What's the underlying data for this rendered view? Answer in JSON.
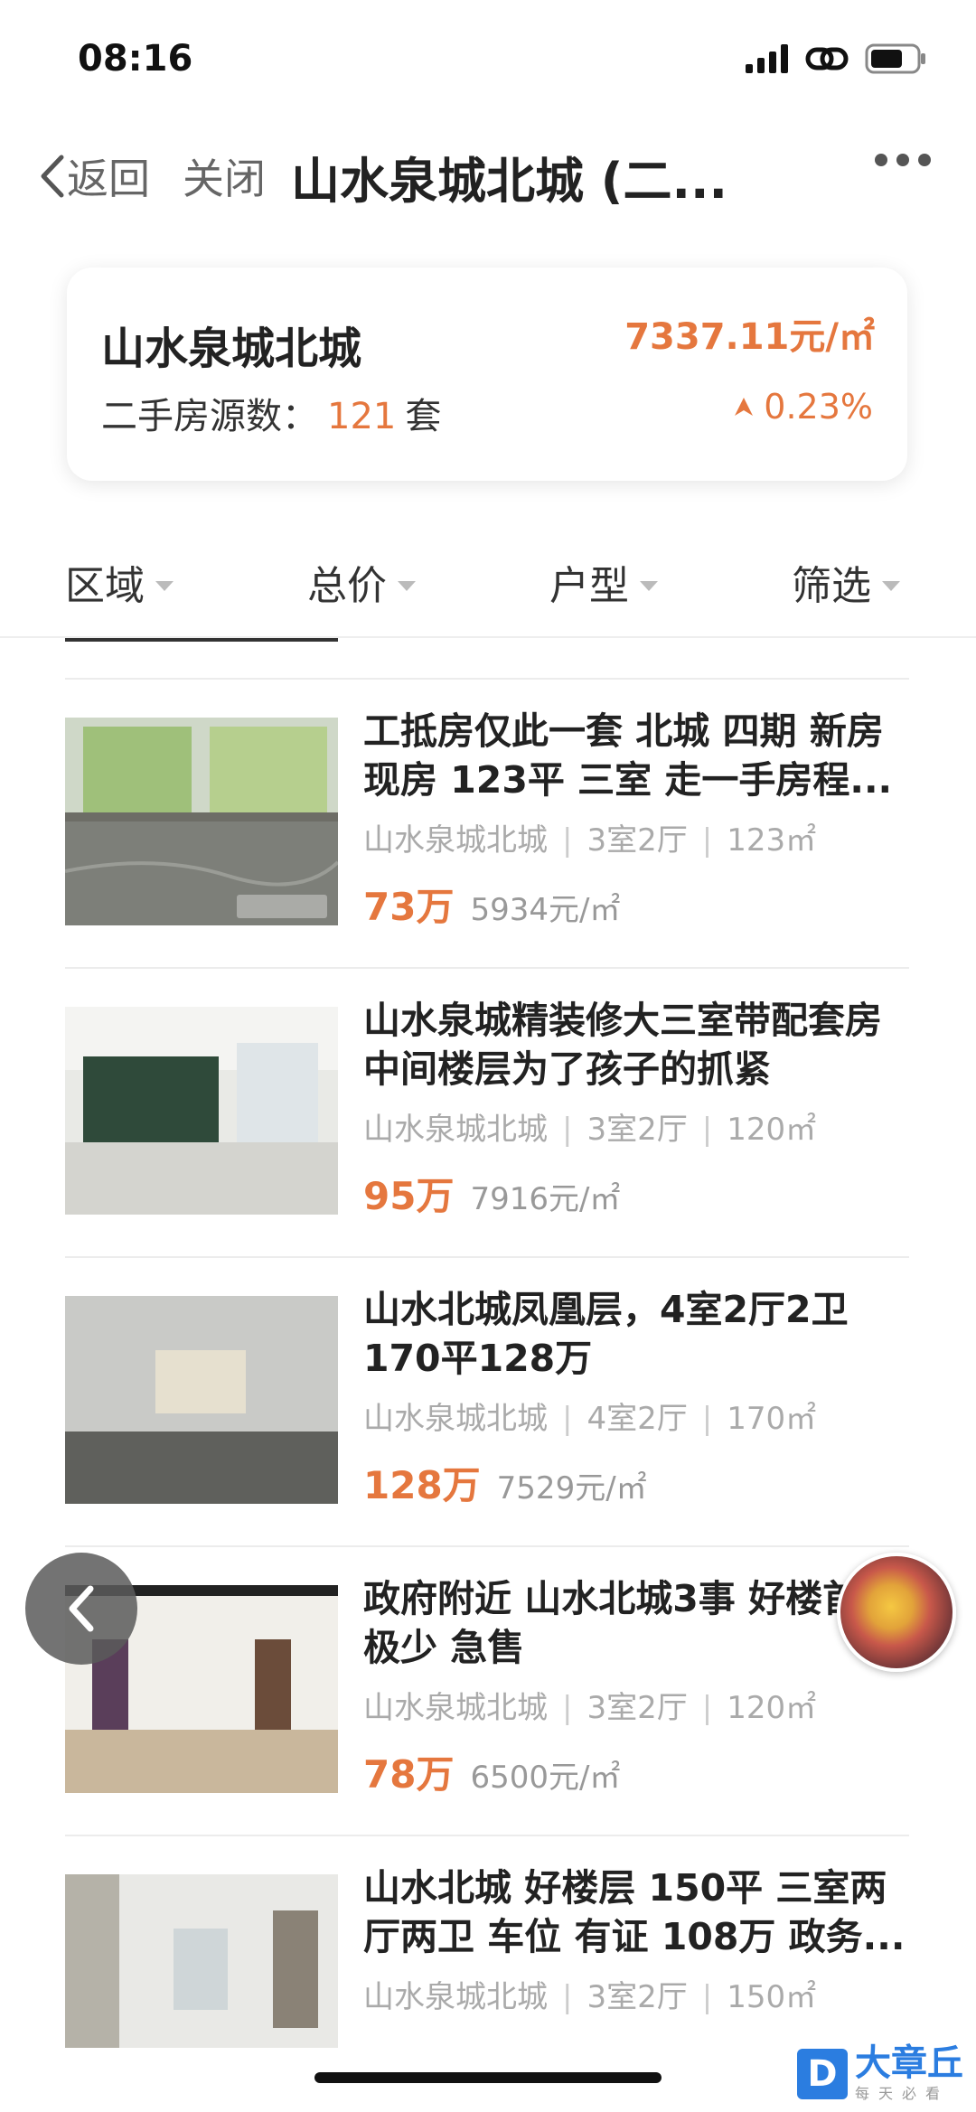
{
  "status": {
    "time": "08:16"
  },
  "nav": {
    "back_label": "返回",
    "close_label": "关闭",
    "title": "山水泉城北城 (二..."
  },
  "summary": {
    "name": "山水泉城北城",
    "count_label": "二手房源数：",
    "count_value": "121",
    "count_unit": "套",
    "avg_price": "7337.11元/㎡",
    "change": "0.23%"
  },
  "filters": [
    {
      "label": "区域"
    },
    {
      "label": "总价"
    },
    {
      "label": "户型"
    },
    {
      "label": "筛选"
    }
  ],
  "listings": [
    {
      "title": "工抵房仅此一套 北城 四期 新房现房 123平 三室 走一手房程...",
      "community": "山水泉城北城",
      "layout": "3室2厅",
      "area": "123㎡",
      "total": "73万",
      "unit_price": "5934元/㎡"
    },
    {
      "title": "山水泉城精装修大三室带配套房中间楼层为了孩子的抓紧",
      "community": "山水泉城北城",
      "layout": "3室2厅",
      "area": "120㎡",
      "total": "95万",
      "unit_price": "7916元/㎡"
    },
    {
      "title": "山水北城凤凰层，4室2厅2卫170平128万",
      "community": "山水泉城北城",
      "layout": "4室2厅",
      "area": "170㎡",
      "total": "128万",
      "unit_price": "7529元/㎡"
    },
    {
      "title": "政府附近 山水北城3事 好楼首付极少 急售",
      "community": "山水泉城北城",
      "layout": "3室2厅",
      "area": "120㎡",
      "total": "78万",
      "unit_price": "6500元/㎡"
    },
    {
      "title": "山水北城 好楼层 150平 三室两厅两卫 车位 有证 108万 政务...",
      "community": "山水泉城北城",
      "layout": "3室2厅",
      "area": "150㎡",
      "total": "",
      "unit_price": ""
    }
  ],
  "watermark": {
    "logo": "D",
    "brand": "大章丘",
    "sub": "每天必看"
  },
  "colors": {
    "accent": "#e5773e",
    "text": "#222222",
    "muted": "#aaaaaa"
  }
}
